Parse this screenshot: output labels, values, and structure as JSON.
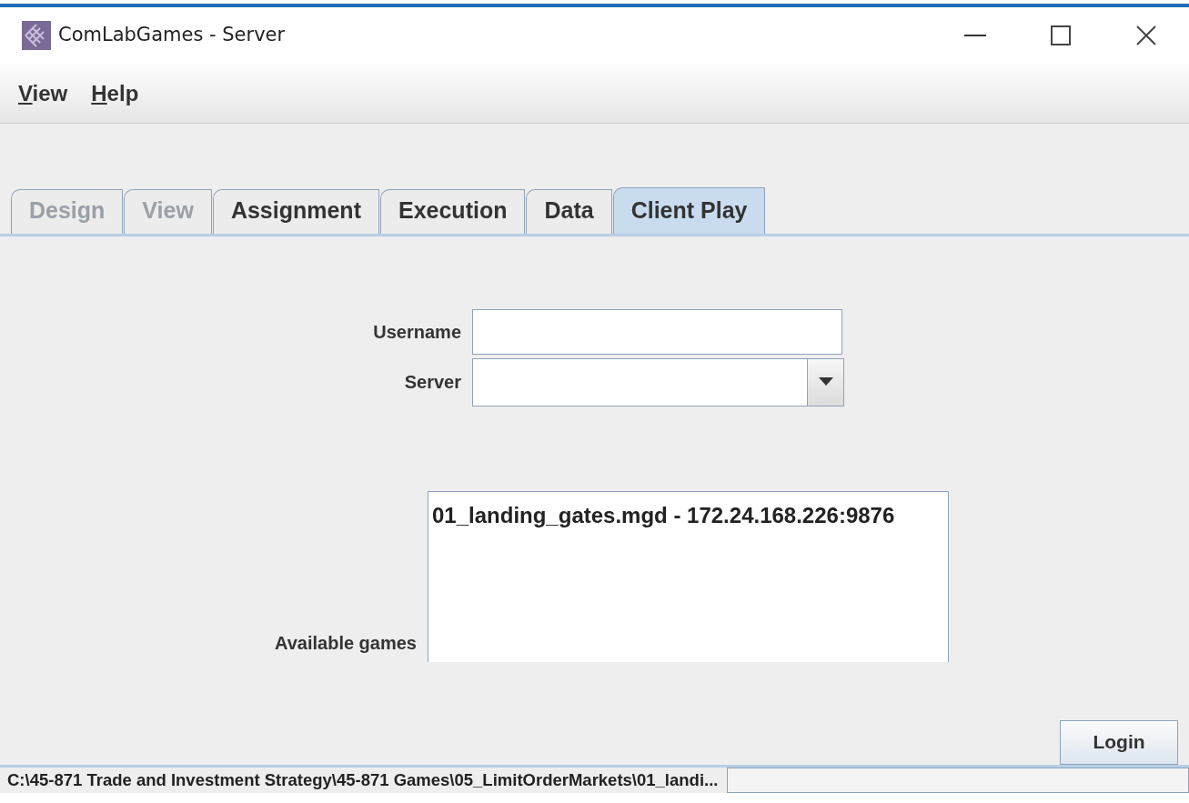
{
  "window": {
    "title": "ComLabGames - Server"
  },
  "menu": [
    "View",
    "Help"
  ],
  "tabs": [
    {
      "label": "Design",
      "selected": false,
      "disabled": true
    },
    {
      "label": "View",
      "selected": false,
      "disabled": true
    },
    {
      "label": "Assignment",
      "selected": false,
      "disabled": false
    },
    {
      "label": "Execution",
      "selected": false,
      "disabled": false
    },
    {
      "label": "Data",
      "selected": false,
      "disabled": false
    },
    {
      "label": "Client Play",
      "selected": true,
      "disabled": false
    }
  ],
  "form": {
    "username_label": "Username",
    "server_label": "Server",
    "games_label": "Available games",
    "games": [
      "01_landing_gates.mgd - 172.24.168.226:9876"
    ],
    "login_button": "Login"
  },
  "status_bar": {
    "path": "C:\\45-871 Trade and Investment Strategy\\45-871 Games\\05_LimitOrderMarkets\\01_landi..."
  }
}
